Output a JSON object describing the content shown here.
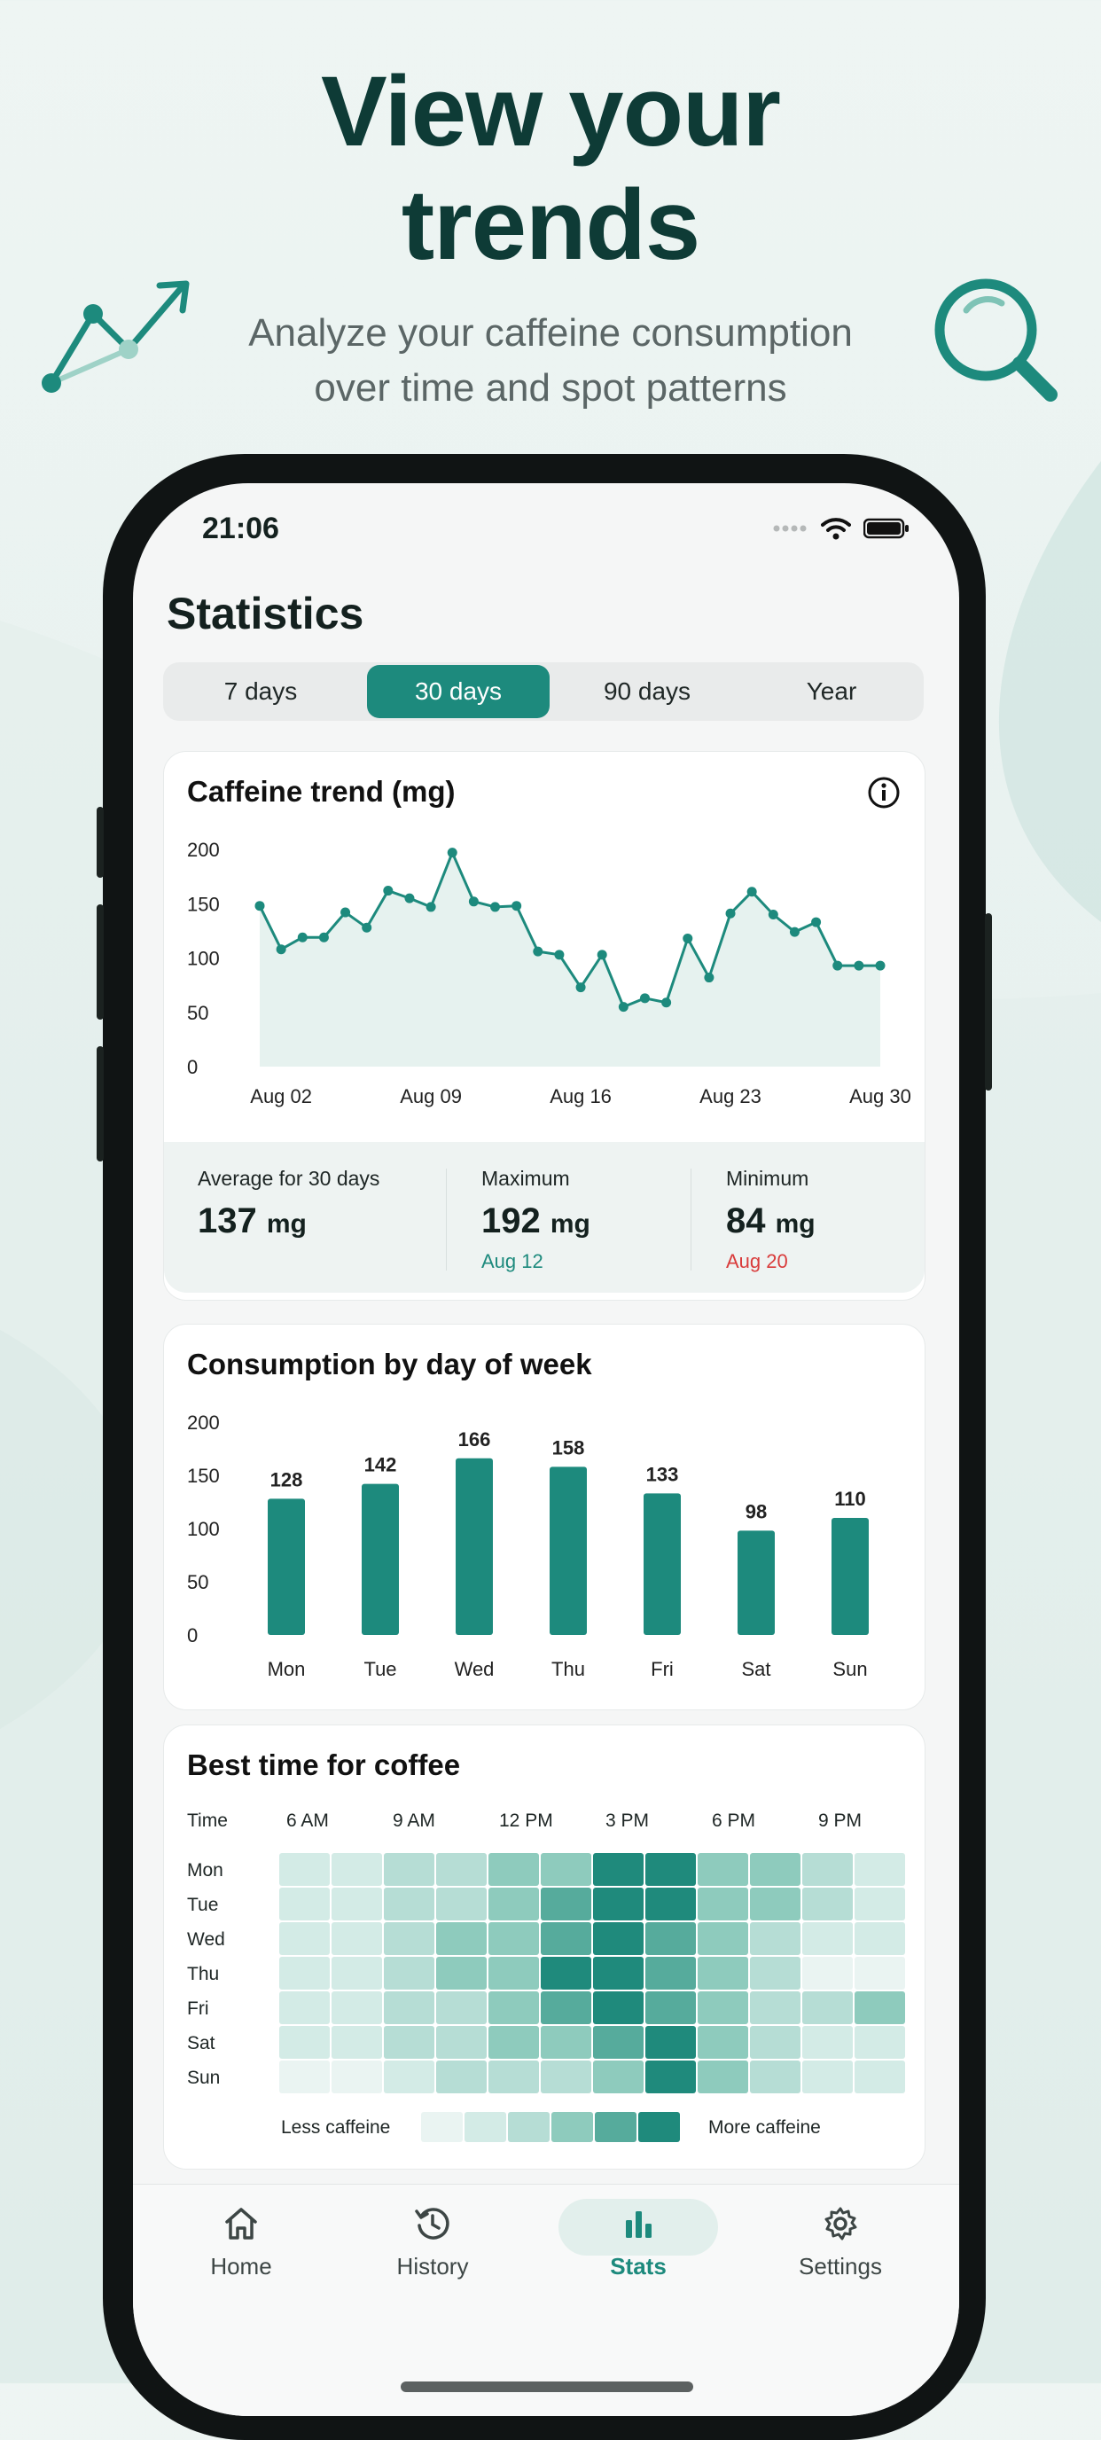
{
  "hero": {
    "title_line1": "View your",
    "title_line2": "trends",
    "subtitle_line1": "Analyze your caffeine consumption",
    "subtitle_line2": "over time and spot patterns"
  },
  "status_bar": {
    "time": "21:06"
  },
  "page": {
    "title": "Statistics"
  },
  "range_tabs": [
    {
      "label": "7 days",
      "active": false
    },
    {
      "label": "30 days",
      "active": true
    },
    {
      "label": "90 days",
      "active": false
    },
    {
      "label": "Year",
      "active": false
    }
  ],
  "trend_card": {
    "title": "Caffeine trend (mg)",
    "info_icon": "info-icon",
    "stats": {
      "average_label": "Average for 30 days",
      "average_value": "137",
      "maximum_label": "Maximum",
      "maximum_value": "192",
      "maximum_date": "Aug 12",
      "minimum_label": "Minimum",
      "minimum_value": "84",
      "minimum_date": "Aug 20",
      "unit": "mg"
    }
  },
  "weekday_card": {
    "title": "Consumption by day of week"
  },
  "heatmap_card": {
    "title": "Best time for coffee",
    "time_header": "Time",
    "time_labels": [
      "6 AM",
      "9 AM",
      "12 PM",
      "3 PM",
      "6 PM",
      "9 PM"
    ],
    "days": [
      "Mon",
      "Tue",
      "Wed",
      "Thu",
      "Fri",
      "Sat",
      "Sun"
    ],
    "levels": [
      [
        1,
        1,
        2,
        2,
        3,
        3,
        5,
        5,
        3,
        3,
        2,
        1
      ],
      [
        1,
        1,
        2,
        2,
        3,
        4,
        5,
        5,
        3,
        3,
        2,
        1
      ],
      [
        1,
        1,
        2,
        3,
        3,
        4,
        5,
        4,
        3,
        2,
        1,
        1
      ],
      [
        1,
        1,
        2,
        3,
        3,
        5,
        5,
        4,
        3,
        2,
        0,
        0
      ],
      [
        1,
        1,
        2,
        2,
        3,
        4,
        5,
        4,
        3,
        2,
        2,
        3
      ],
      [
        1,
        1,
        2,
        2,
        3,
        3,
        4,
        5,
        3,
        2,
        1,
        1
      ],
      [
        0,
        0,
        1,
        2,
        2,
        2,
        3,
        5,
        3,
        2,
        1,
        1
      ]
    ],
    "legend_less": "Less caffeine",
    "legend_more": "More caffeine",
    "palette": [
      "#eaf4f2",
      "#d3ebe6",
      "#b6ddd5",
      "#8ecbbd",
      "#56ab9c",
      "#1f8a7c"
    ]
  },
  "tab_bar": [
    {
      "label": "Home",
      "icon": "home-icon",
      "active": false
    },
    {
      "label": "History",
      "icon": "history-icon",
      "active": false
    },
    {
      "label": "Stats",
      "icon": "bar-chart-icon",
      "active": true
    },
    {
      "label": "Settings",
      "icon": "gear-icon",
      "active": false
    }
  ],
  "colors": {
    "accent": "#1d8a7d",
    "title": "#0e3b36",
    "max_date": "#1d8a7d",
    "min_date": "#d93b3b"
  },
  "chart_data": [
    {
      "type": "line",
      "title": "Caffeine trend (mg)",
      "x": [
        "Aug 01",
        "Aug 02",
        "Aug 03",
        "Aug 04",
        "Aug 05",
        "Aug 06",
        "Aug 07",
        "Aug 08",
        "Aug 09",
        "Aug 10",
        "Aug 11",
        "Aug 12",
        "Aug 13",
        "Aug 14",
        "Aug 15",
        "Aug 16",
        "Aug 17",
        "Aug 18",
        "Aug 19",
        "Aug 20",
        "Aug 21",
        "Aug 22",
        "Aug 23",
        "Aug 24",
        "Aug 25",
        "Aug 26",
        "Aug 27",
        "Aug 28",
        "Aug 29",
        "Aug 30"
      ],
      "values": [
        148,
        108,
        119,
        119,
        142,
        128,
        162,
        155,
        147,
        197,
        152,
        147,
        148,
        106,
        103,
        73,
        103,
        55,
        63,
        59,
        118,
        82,
        141,
        161,
        140,
        124,
        133,
        93,
        93,
        93
      ],
      "x_tick_labels": [
        "Aug 02",
        "Aug 09",
        "Aug 16",
        "Aug 23",
        "Aug 30"
      ],
      "y_ticks": [
        "0",
        "50",
        "100",
        "150",
        "200"
      ],
      "ylim": [
        0,
        200
      ],
      "grid": false,
      "area_fill": true
    },
    {
      "type": "bar",
      "title": "Consumption by day of week",
      "categories": [
        "Mon",
        "Tue",
        "Wed",
        "Thu",
        "Fri",
        "Sat",
        "Sun"
      ],
      "values": [
        128,
        142,
        166,
        158,
        133,
        98,
        110
      ],
      "data_labels": [
        "128",
        "142",
        "166",
        "158",
        "133",
        "98",
        "110"
      ],
      "y_ticks": [
        "0",
        "50",
        "100",
        "150",
        "200"
      ],
      "ylim": [
        0,
        200
      ],
      "grid": false
    }
  ]
}
